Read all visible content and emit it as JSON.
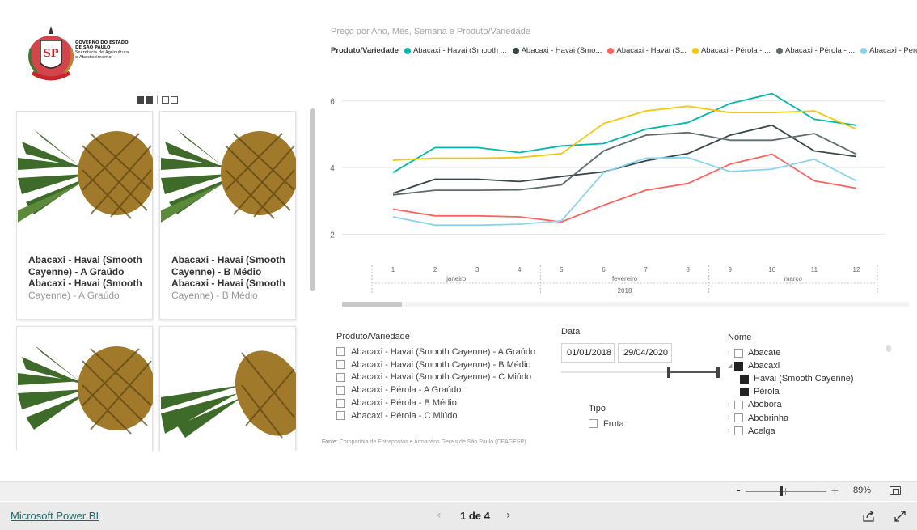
{
  "logo": {
    "line1": "GOVERNO DO ESTADO",
    "line2": "DE SÃO PAULO",
    "line3": "Secretaria de Agricultura",
    "line4": "e Abastecimento"
  },
  "cards": [
    {
      "title": "Abacaxi - Havai (Smooth Cayenne) - A Graúdo",
      "subtitle": "Abacaxi - Havai (Smooth",
      "subtitle_rest": "Cayenne) - A Graúdo"
    },
    {
      "title": "Abacaxi - Havai (Smooth Cayenne) - B Médio",
      "subtitle": "Abacaxi - Havai (Smooth",
      "subtitle_rest": "Cayenne) - B Médio"
    },
    {
      "title": "",
      "subtitle": "",
      "subtitle_rest": ""
    },
    {
      "title": "",
      "subtitle": "",
      "subtitle_rest": ""
    }
  ],
  "chart_title": "Preço por Ano, Mês, Semana e Produto/Variedade",
  "legend": {
    "title": "Produto/Variedade",
    "items": [
      {
        "label": "Abacaxi - Havai (Smooth ...",
        "color": "#01B8AA"
      },
      {
        "label": "Abacaxi - Havai (Smo...",
        "color": "#374649"
      },
      {
        "label": "Abacaxi - Havai (S...",
        "color": "#FD625E"
      },
      {
        "label": "Abacaxi - Pérola - ...",
        "color": "#F2C80F"
      },
      {
        "label": "Abacaxi - Pérola - ...",
        "color": "#5F6B6D"
      },
      {
        "label": "Abacaxi - Pérol...",
        "color": "#8AD4EB"
      }
    ]
  },
  "chart_data": {
    "type": "line",
    "x": [
      1,
      2,
      3,
      4,
      5,
      6,
      7,
      8,
      9,
      10,
      11,
      12
    ],
    "month_labels": [
      "janeiro",
      "fevereiro",
      "março"
    ],
    "year_label": "2018",
    "yticks": [
      2,
      4,
      6
    ],
    "ylim": [
      1.5,
      6.6
    ],
    "series": [
      {
        "name": "Abacaxi - Havai (Smooth ...",
        "color": "#01B8AA",
        "values": [
          3.85,
          4.6,
          4.6,
          4.45,
          4.65,
          4.72,
          5.15,
          5.35,
          5.92,
          6.22,
          5.45,
          5.27
        ]
      },
      {
        "name": "Abacaxi - Havai (Smo...",
        "color": "#374649",
        "values": [
          3.23,
          3.65,
          3.65,
          3.58,
          3.73,
          3.87,
          4.2,
          4.42,
          4.97,
          5.27,
          4.5,
          4.33
        ]
      },
      {
        "name": "Abacaxi - Havai (S...",
        "color": "#FD625E",
        "values": [
          2.75,
          2.55,
          2.55,
          2.52,
          2.37,
          2.87,
          3.32,
          3.52,
          4.1,
          4.4,
          3.6,
          3.38
        ]
      },
      {
        "name": "Abacaxi - Pérola - ...",
        "color": "#F2C80F",
        "values": [
          4.22,
          4.28,
          4.28,
          4.3,
          4.42,
          5.32,
          5.7,
          5.84,
          5.65,
          5.65,
          5.7,
          5.15
        ]
      },
      {
        "name": "Abacaxi - Pérola - ...",
        "color": "#5F6B6D",
        "values": [
          3.18,
          3.32,
          3.32,
          3.33,
          3.48,
          4.5,
          4.97,
          5.05,
          4.82,
          4.82,
          5.02,
          4.4
        ]
      },
      {
        "name": "Abacaxi - Pérol...",
        "color": "#8AD4EB",
        "values": [
          2.52,
          2.27,
          2.27,
          2.3,
          2.4,
          3.85,
          4.28,
          4.3,
          3.88,
          3.95,
          4.25,
          3.6
        ]
      }
    ]
  },
  "produto_slicer": {
    "title": "Produto/Variedade",
    "items": [
      "Abacaxi - Havai (Smooth Cayenne) - A Graúdo",
      "Abacaxi - Havai (Smooth Cayenne) - B Médio",
      "Abacaxi - Havai (Smooth Cayenne) - C Miúdo",
      "Abacaxi - Pérola - A Graúdo",
      "Abacaxi - Pérola - B Médio",
      "Abacaxi - Pérola - C Miúdo"
    ]
  },
  "data_slicer": {
    "title": "Data",
    "start": "01/01/2018",
    "end": "29/04/2020"
  },
  "tipo_slicer": {
    "title": "Tipo",
    "items": [
      "Fruta"
    ]
  },
  "nome_slicer": {
    "title": "Nome",
    "items": [
      {
        "label": "Abacate",
        "level": 0,
        "expander": "›",
        "checked": false
      },
      {
        "label": "Abacaxi",
        "level": 0,
        "expander": "◢",
        "checked": true
      },
      {
        "label": "Havai (Smooth Cayenne)",
        "level": 1,
        "expander": "",
        "checked": true
      },
      {
        "label": "Pérola",
        "level": 1,
        "expander": "",
        "checked": true
      },
      {
        "label": "Abóbora",
        "level": 0,
        "expander": "›",
        "checked": false
      },
      {
        "label": "Abobrinha",
        "level": 0,
        "expander": "›",
        "checked": false
      },
      {
        "label": "Acelga",
        "level": 0,
        "expander": "›",
        "checked": false
      }
    ]
  },
  "source": {
    "prefix": "Fonte:",
    "text": "Companhia de Entrepostos e Armazéns Gerais de São Paulo (CEAGESP)"
  },
  "zoom": {
    "minus": "-",
    "plus": "+",
    "percent": "89%",
    "level": 0.42
  },
  "footer": {
    "brand": "Microsoft Power BI",
    "page": "1 de 4",
    "prev": "‹",
    "next": "›"
  }
}
